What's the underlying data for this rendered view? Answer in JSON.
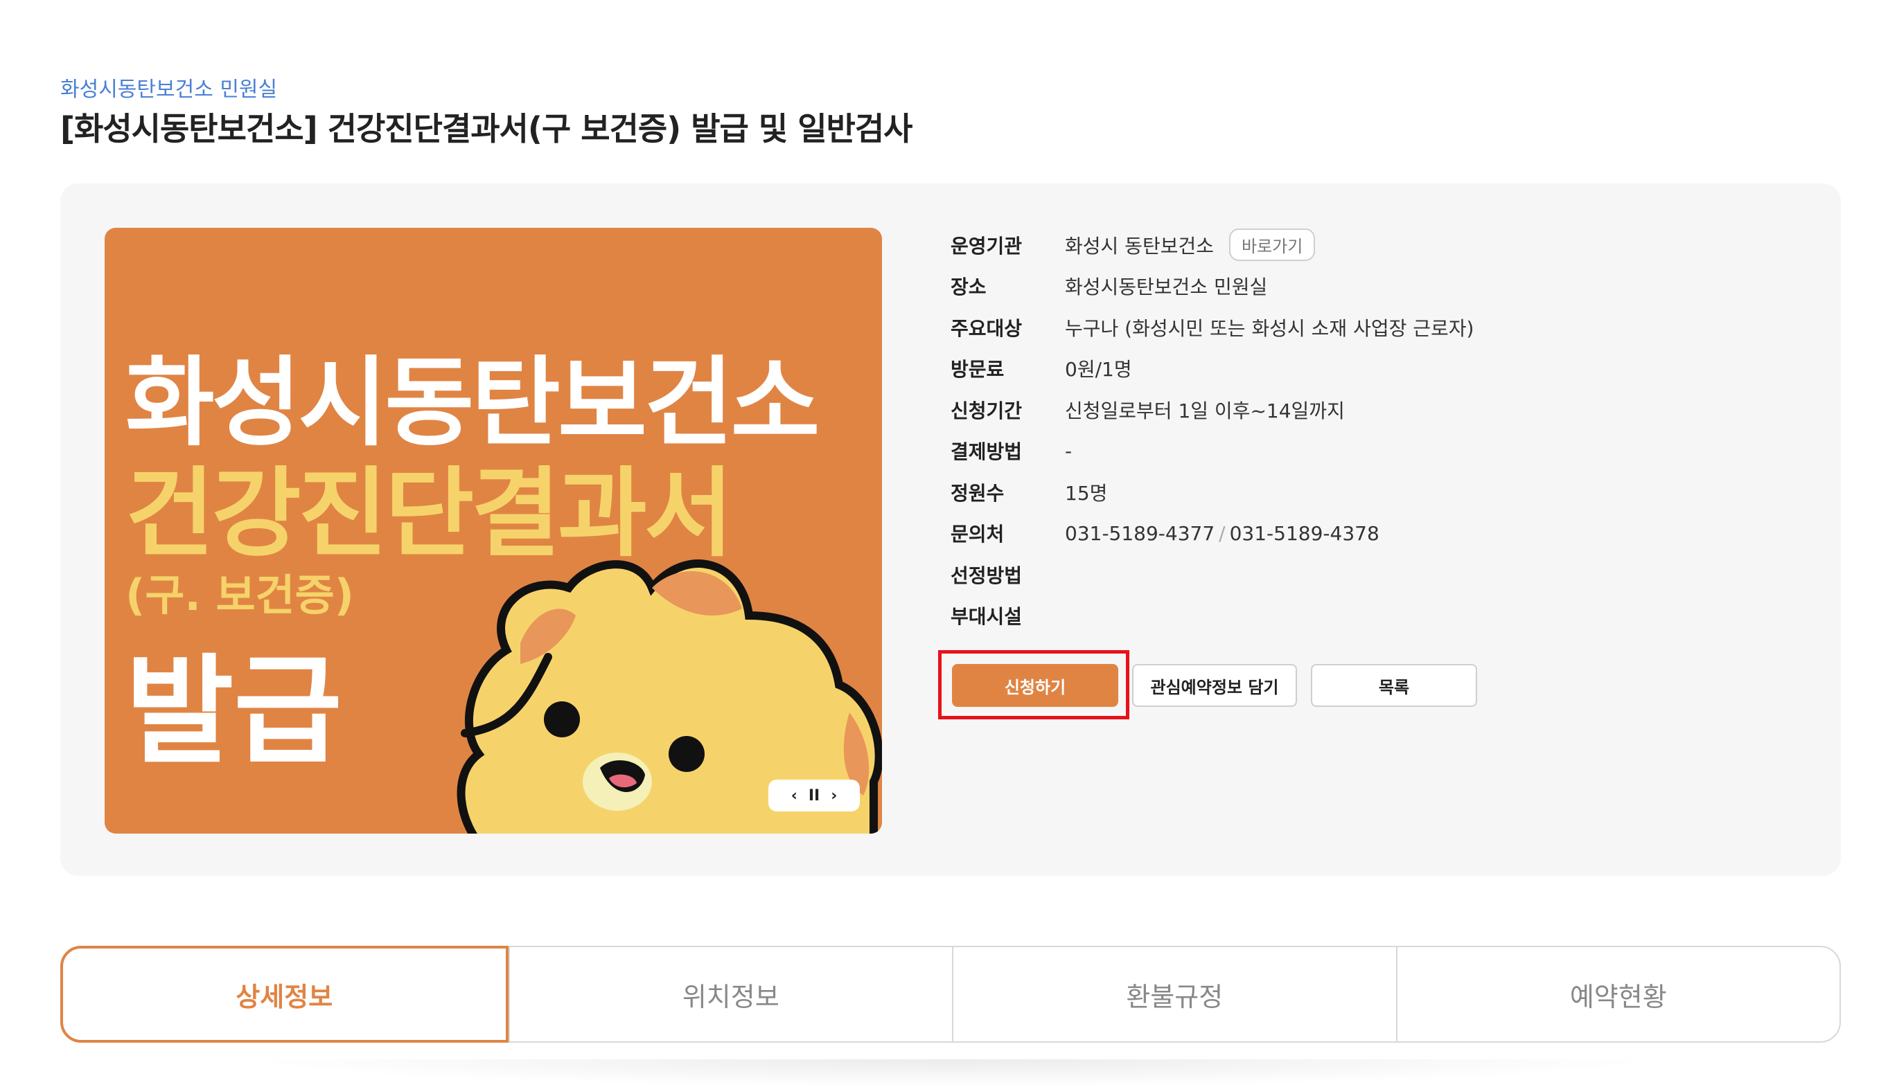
{
  "breadcrumb": "화성시동탄보건소 민원실",
  "title": "[화성시동탄보건소] 건강진단결과서(구 보건증) 발급 및 일반검사",
  "banner": {
    "line1": "화성시동탄보건소",
    "line2": "건강진단결과서",
    "line3": "(구. 보건증)",
    "line4": "발급",
    "prev_label": "‹",
    "pause_label": "II",
    "next_label": "›"
  },
  "details": {
    "operator_label": "운영기관",
    "operator_value": "화성시 동탄보건소",
    "shortcut_label": "바로가기",
    "place_label": "장소",
    "place_value": "화성시동탄보건소 민원실",
    "target_label": "주요대상",
    "target_value": "누구나 (화성시민 또는 화성시 소재 사업장 근로자)",
    "fee_label": "방문료",
    "fee_value": "0원/1명",
    "period_label": "신청기간",
    "period_value": "신청일로부터 1일 이후~14일까지",
    "payment_label": "결제방법",
    "payment_value": "-",
    "capacity_label": "정원수",
    "capacity_value": "15명",
    "contact_label": "문의처",
    "contact_value1": "031-5189-4377",
    "contact_sep": "/",
    "contact_value2": "031-5189-4378",
    "selection_label": "선정방법",
    "selection_value": "",
    "facility_label": "부대시설",
    "facility_value": ""
  },
  "buttons": {
    "apply": "신청하기",
    "wishlist": "관심예약정보 담기",
    "list": "목록"
  },
  "tabs": [
    "상세정보",
    "위치정보",
    "환불규정",
    "예약현황"
  ],
  "colors": {
    "accent": "#e08444",
    "highlight": "#e8111b",
    "link": "#4a7fd4"
  }
}
